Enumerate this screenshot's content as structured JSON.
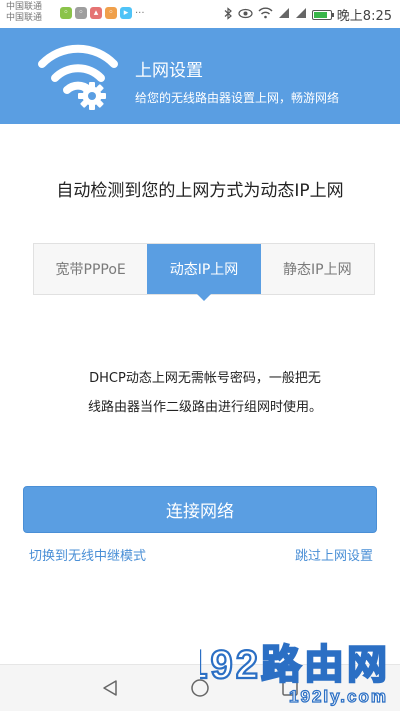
{
  "status_bar": {
    "carrier1": "中国联通",
    "carrier2": "中国联通",
    "time": "晚上8:25",
    "battery_level": 0.85
  },
  "header": {
    "title": "上网设置",
    "subtitle": "给您的无线路由器设置上网，畅游网络"
  },
  "main": {
    "detect_title": "自动检测到您的上网方式为动态IP上网",
    "tabs": [
      {
        "label": "宽带PPPoE",
        "active": false
      },
      {
        "label": "动态IP上网",
        "active": true
      },
      {
        "label": "静态IP上网",
        "active": false
      }
    ],
    "description_line1": "DHCP动态上网无需帐号密码，一般把无",
    "description_line2": "线路由器当作二级路由进行组网时使用。",
    "connect_label": "连接网络",
    "link_repeater": "切换到无线中继模式",
    "link_skip": "跳过上网设置"
  },
  "watermark": {
    "text": "192路由网",
    "url": "192ly.com"
  },
  "colors": {
    "primary": "#5a9ee2",
    "link": "#4a8fd6",
    "watermark": "#2b6fc4"
  },
  "icons": {
    "logo": "wifi-gear-icon",
    "back": "back-triangle-icon",
    "home": "home-circle-icon",
    "recent": "recent-square-icon"
  }
}
